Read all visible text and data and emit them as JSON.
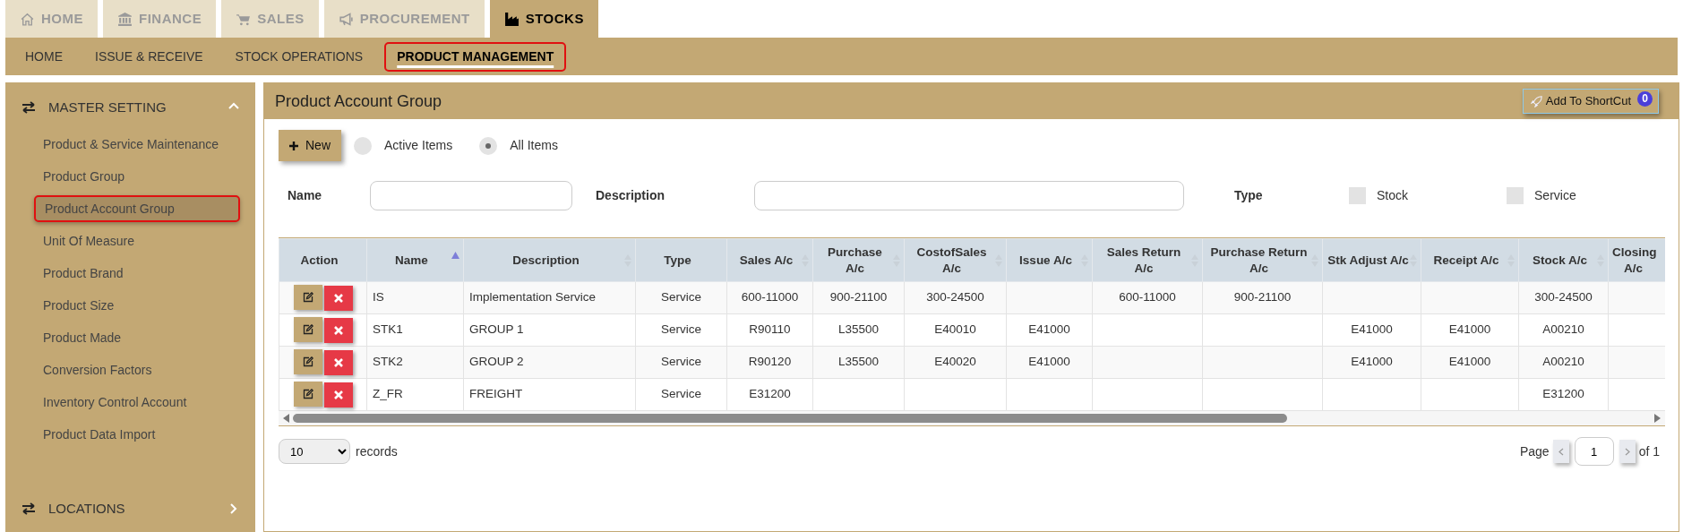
{
  "top_tabs": [
    {
      "label": "HOME",
      "selected": false
    },
    {
      "label": "FINANCE",
      "selected": false
    },
    {
      "label": "SALES",
      "selected": false
    },
    {
      "label": "PROCUREMENT",
      "selected": false
    },
    {
      "label": "STOCKS",
      "selected": true
    }
  ],
  "sub_nav": [
    {
      "label": "HOME",
      "selected": false
    },
    {
      "label": "ISSUE & RECEIVE",
      "selected": false
    },
    {
      "label": "STOCK OPERATIONS",
      "selected": false
    },
    {
      "label": "PRODUCT MANAGEMENT",
      "selected": true
    }
  ],
  "sidebar": {
    "sections": [
      {
        "title": "MASTER SETTING",
        "expanded": true,
        "items": [
          {
            "label": "Product & Service Maintenance",
            "selected": false
          },
          {
            "label": "Product Group",
            "selected": false
          },
          {
            "label": "Product Account Group",
            "selected": true
          },
          {
            "label": "Unit Of Measure",
            "selected": false
          },
          {
            "label": "Product Brand",
            "selected": false
          },
          {
            "label": "Product Size",
            "selected": false
          },
          {
            "label": "Product Made",
            "selected": false
          },
          {
            "label": "Conversion Factors",
            "selected": false
          },
          {
            "label": "Inventory Control Account",
            "selected": false
          },
          {
            "label": "Product Data Import",
            "selected": false
          }
        ]
      },
      {
        "title": "LOCATIONS",
        "expanded": false
      }
    ]
  },
  "panel": {
    "title": "Product Account Group",
    "shortcut_button": {
      "label": "Add To ShortCut",
      "badge": "0"
    },
    "new_button": "New",
    "filter_radios": [
      {
        "label": "Active Items",
        "selected": false
      },
      {
        "label": "All Items",
        "selected": true
      }
    ],
    "filters": {
      "name_label": "Name",
      "description_label": "Description",
      "type_label": "Type",
      "type_options": [
        {
          "label": "Stock",
          "checked": false
        },
        {
          "label": "Service",
          "checked": false
        }
      ]
    },
    "table": {
      "columns": [
        {
          "label": "Action",
          "sorted": false
        },
        {
          "label": "Name",
          "sorted": true
        },
        {
          "label": "Description",
          "sorted": false
        },
        {
          "label": "Type",
          "sorted": false
        },
        {
          "label": "Sales A/c",
          "sorted": false
        },
        {
          "label": "Purchase A/c",
          "sorted": false
        },
        {
          "label": "CostofSales A/c",
          "sorted": false
        },
        {
          "label": "Issue A/c",
          "sorted": false
        },
        {
          "label": "Sales Return A/c",
          "sorted": false
        },
        {
          "label": "Purchase Return A/c",
          "sorted": false
        },
        {
          "label": "Stk Adjust A/c",
          "sorted": false
        },
        {
          "label": "Receipt A/c",
          "sorted": false
        },
        {
          "label": "Stock A/c",
          "sorted": false
        },
        {
          "label": "Closing A/c",
          "sorted": false
        }
      ],
      "rows": [
        [
          "",
          "IS",
          "Implementation Service",
          "Service",
          "600-11000",
          "900-21100",
          "300-24500",
          "",
          "600-11000",
          "900-21100",
          "",
          "",
          "300-24500",
          ""
        ],
        [
          "",
          "STK1",
          "GROUP 1",
          "Service",
          "R90110",
          "L35500",
          "E40010",
          "E41000",
          "",
          "",
          "E41000",
          "E41000",
          "A00210",
          ""
        ],
        [
          "",
          "STK2",
          "GROUP 2",
          "Service",
          "R90120",
          "L35500",
          "E40020",
          "E41000",
          "",
          "",
          "E41000",
          "E41000",
          "A00210",
          ""
        ],
        [
          "",
          "Z_FR",
          "FREIGHT",
          "Service",
          "E31200",
          "",
          "",
          "",
          "",
          "",
          "",
          "",
          "E31200",
          ""
        ]
      ]
    },
    "page_size": "10",
    "records_label": "records",
    "pager": {
      "page_label": "Page",
      "page": "1",
      "of_label": "of 1"
    }
  }
}
